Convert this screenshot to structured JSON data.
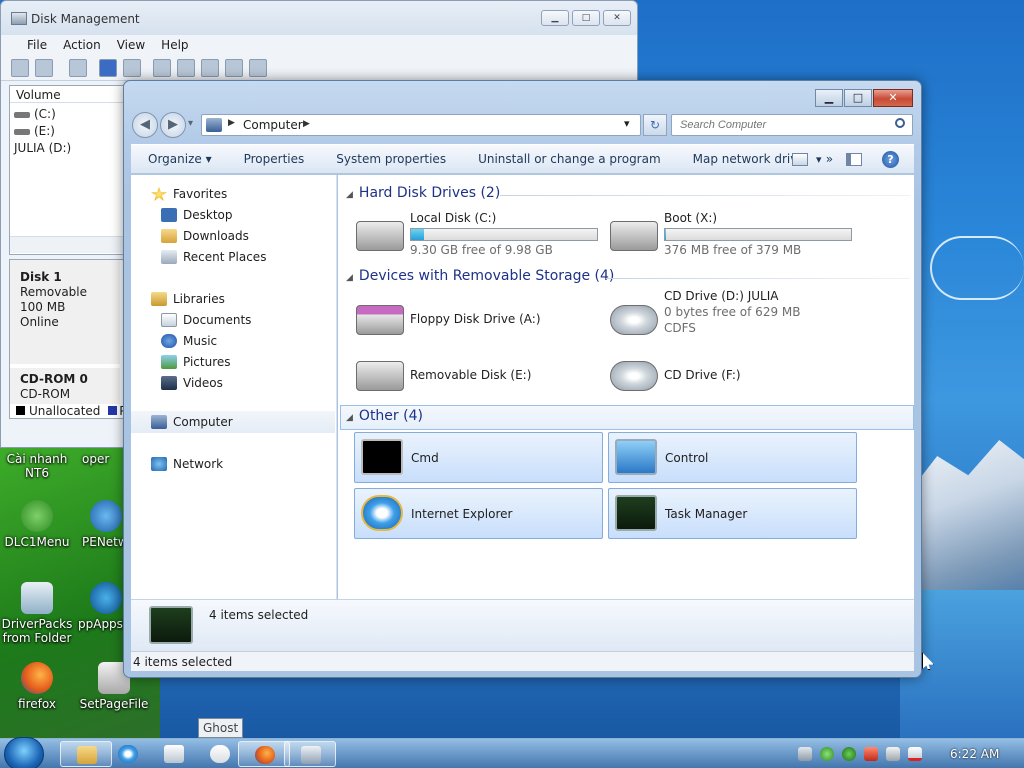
{
  "desktop": {
    "icons": [
      {
        "label_lines": [
          "Cài nhanh",
          "NT6"
        ]
      },
      {
        "label_lines": [
          "oper"
        ]
      },
      {
        "label_lines": [
          "DLC1Menu"
        ]
      },
      {
        "label_lines": [
          "PENetw"
        ]
      },
      {
        "label_lines": [
          "DriverPacks",
          "from Folder"
        ]
      },
      {
        "label_lines": [
          "ppAppsi"
        ]
      },
      {
        "label_lines": [
          "firefox"
        ]
      },
      {
        "label_lines": [
          "SetPageFile"
        ]
      }
    ]
  },
  "disk_mgmt": {
    "title": "Disk Management",
    "caption": {
      "min": "▁",
      "max": "□",
      "close": "✕"
    },
    "menu": [
      "File",
      "Action",
      "View",
      "Help"
    ],
    "volume_header": "Volume",
    "volumes": [
      "(C:)",
      "(E:)",
      "JULIA (D:)"
    ],
    "disk1": {
      "name": "Disk 1",
      "type": "Removable",
      "size": "100 MB",
      "state": "Online"
    },
    "cdrom": {
      "name": "CD-ROM 0",
      "type": "CD-ROM"
    },
    "legend": {
      "unallocated": "Unallocated",
      "p": "P"
    }
  },
  "explorer": {
    "caption": {
      "min": "▁",
      "max": "□",
      "close": "✕"
    },
    "nav": {
      "back": "◀",
      "forward": "▶",
      "dropdown": "▾"
    },
    "address": {
      "crumb": "Computer",
      "sep": "▶",
      "dropdown": "▾",
      "refresh": "↻"
    },
    "search": {
      "placeholder": "Search Computer"
    },
    "commands": [
      "Organize ▾",
      "Properties",
      "System properties",
      "Uninstall or change a program",
      "Map network drive",
      "»"
    ],
    "views_arrow": "▾",
    "help": "?",
    "navpane": {
      "favorites": "Favorites",
      "favorites_items": [
        "Desktop",
        "Downloads",
        "Recent Places"
      ],
      "libraries": "Libraries",
      "libraries_items": [
        "Documents",
        "Music",
        "Pictures",
        "Videos"
      ],
      "computer": "Computer",
      "network": "Network"
    },
    "groups": {
      "hard": "Hard Disk Drives (2)",
      "removable": "Devices with Removable Storage (4)",
      "other": "Other (4)"
    },
    "drives": {
      "c": {
        "name": "Local Disk (C:)",
        "free": "9.30 GB free of 9.98 GB",
        "used_fraction": 0.068
      },
      "x": {
        "name": "Boot (X:)",
        "free": "376 MB free of 379 MB",
        "used_fraction": 0.008
      },
      "floppy": {
        "name": "Floppy Disk Drive (A:)"
      },
      "cdd": {
        "name": "CD Drive (D:) JULIA",
        "free": "0 bytes free of 629 MB",
        "fs": "CDFS"
      },
      "rem": {
        "name": "Removable Disk (E:)"
      },
      "cdf": {
        "name": "CD Drive (F:)"
      }
    },
    "other_items": [
      "Cmd",
      "Control",
      "Internet Explorer",
      "Task Manager"
    ],
    "details": "4 items selected",
    "status": "4 items selected"
  },
  "taskbar": {
    "tooltip": "Ghost",
    "clock": "6:22 AM"
  }
}
